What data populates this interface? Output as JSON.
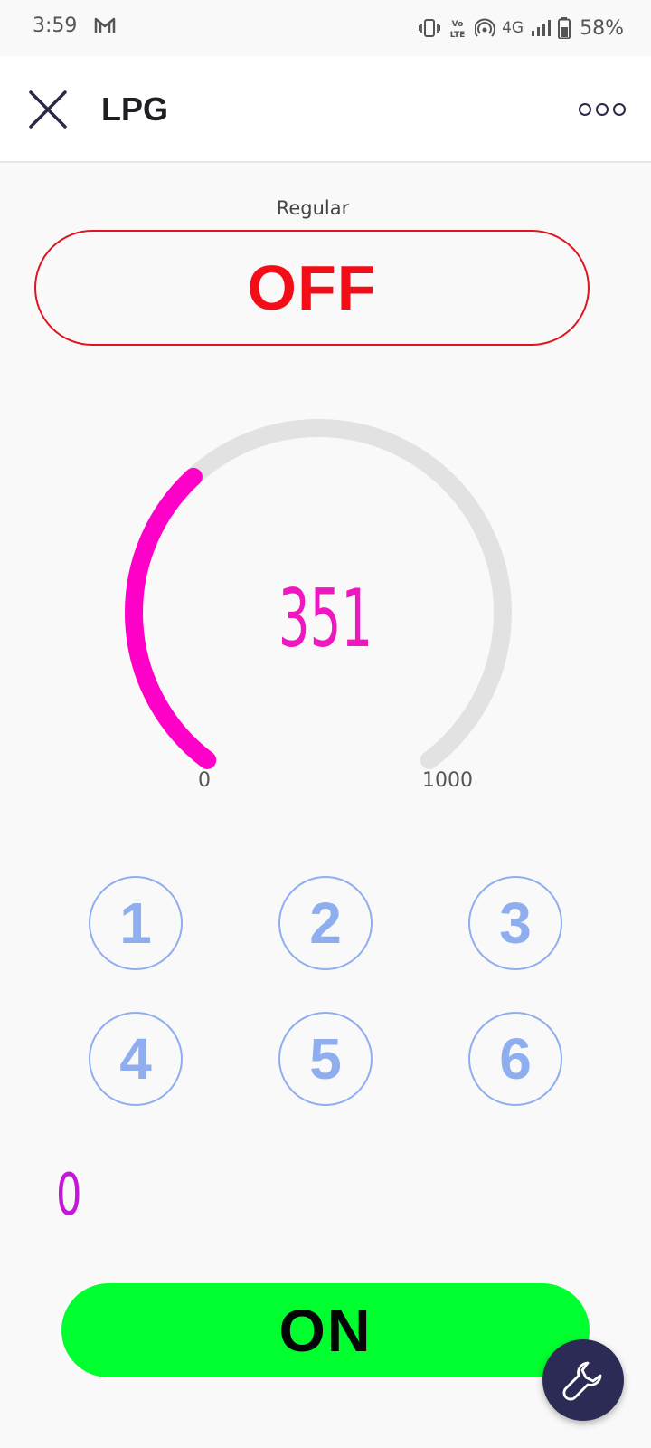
{
  "status_bar": {
    "time": "3:59",
    "network": "4G",
    "battery": "58%",
    "icons": [
      "gmail-icon",
      "vibrate-icon",
      "volte-icon",
      "hotspot-icon",
      "signal-icon",
      "battery-icon"
    ]
  },
  "app_bar": {
    "title": "LPG",
    "close_icon": "close-icon",
    "more_icon": "more-icon"
  },
  "mode": {
    "label": "Regular",
    "state": "OFF",
    "color": "#f20d17"
  },
  "gauge": {
    "value": "351",
    "min": "0",
    "max": "1000",
    "fraction": 0.351,
    "color": "#ff00c8",
    "track_color": "#e2e2e2"
  },
  "keypad": {
    "keys": [
      "1",
      "2",
      "3",
      "4",
      "5",
      "6"
    ],
    "color": "#8eaef0"
  },
  "counter": {
    "value": "0",
    "color": "#c418d8"
  },
  "power_button": {
    "label": "ON",
    "color": "#00ff2e"
  },
  "fab": {
    "icon": "wrench-icon",
    "color": "#2b2b55"
  }
}
